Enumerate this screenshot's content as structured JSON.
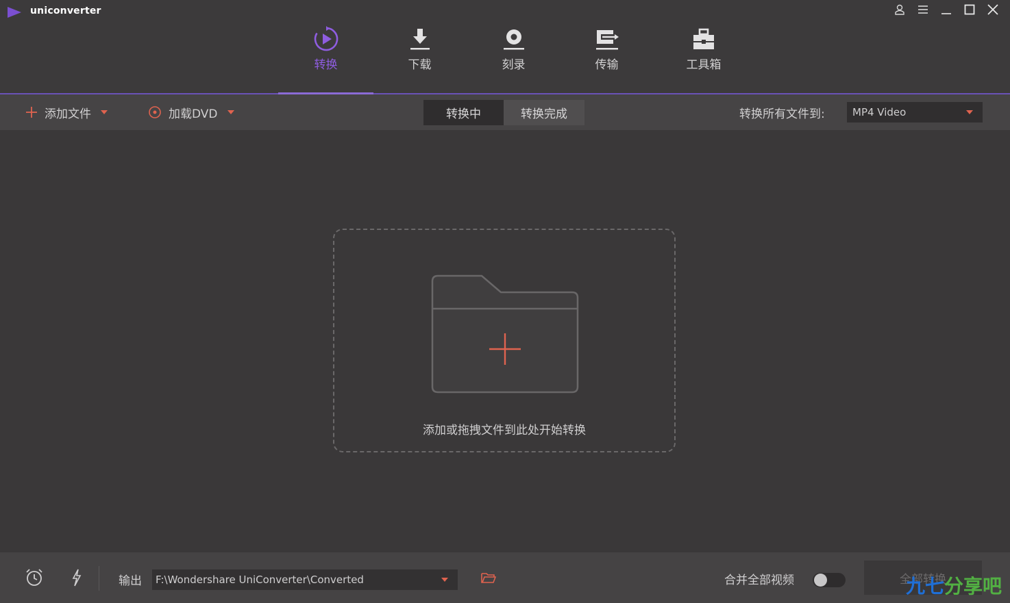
{
  "app": {
    "name": "uniconverter"
  },
  "window_controls": [
    {
      "icon": "user-icon"
    },
    {
      "icon": "menu-icon"
    },
    {
      "icon": "minimize-icon"
    },
    {
      "icon": "maximize-icon"
    },
    {
      "icon": "close-icon"
    }
  ],
  "nav": {
    "active_index": 0,
    "tabs": [
      {
        "label": "转换",
        "icon": "convert-icon"
      },
      {
        "label": "下载",
        "icon": "download-icon"
      },
      {
        "label": "刻录",
        "icon": "burn-icon"
      },
      {
        "label": "传输",
        "icon": "transfer-icon"
      },
      {
        "label": "工具箱",
        "icon": "toolbox-icon"
      }
    ]
  },
  "toolbar": {
    "add_files": "添加文件",
    "load_dvd": "加载DVD",
    "segments": {
      "converting": "转换中",
      "finished": "转换完成"
    },
    "convert_all_to_label": "转换所有文件到:",
    "format_value": "MP4 Video"
  },
  "dropzone": {
    "hint": "添加或拖拽文件到此处开始转换"
  },
  "bottom": {
    "output_label": "输出",
    "output_path": "F:\\Wondershare UniConverter\\Converted",
    "merge_label": "合并全部视频",
    "merge_enabled": false,
    "convert_all_button": "全部转换"
  },
  "watermark": {
    "part1": "九七",
    "part2": "分享吧"
  },
  "colors": {
    "accent_purple": "#8f5de0",
    "accent_orange": "#e0634f",
    "background": "#3a3839"
  }
}
